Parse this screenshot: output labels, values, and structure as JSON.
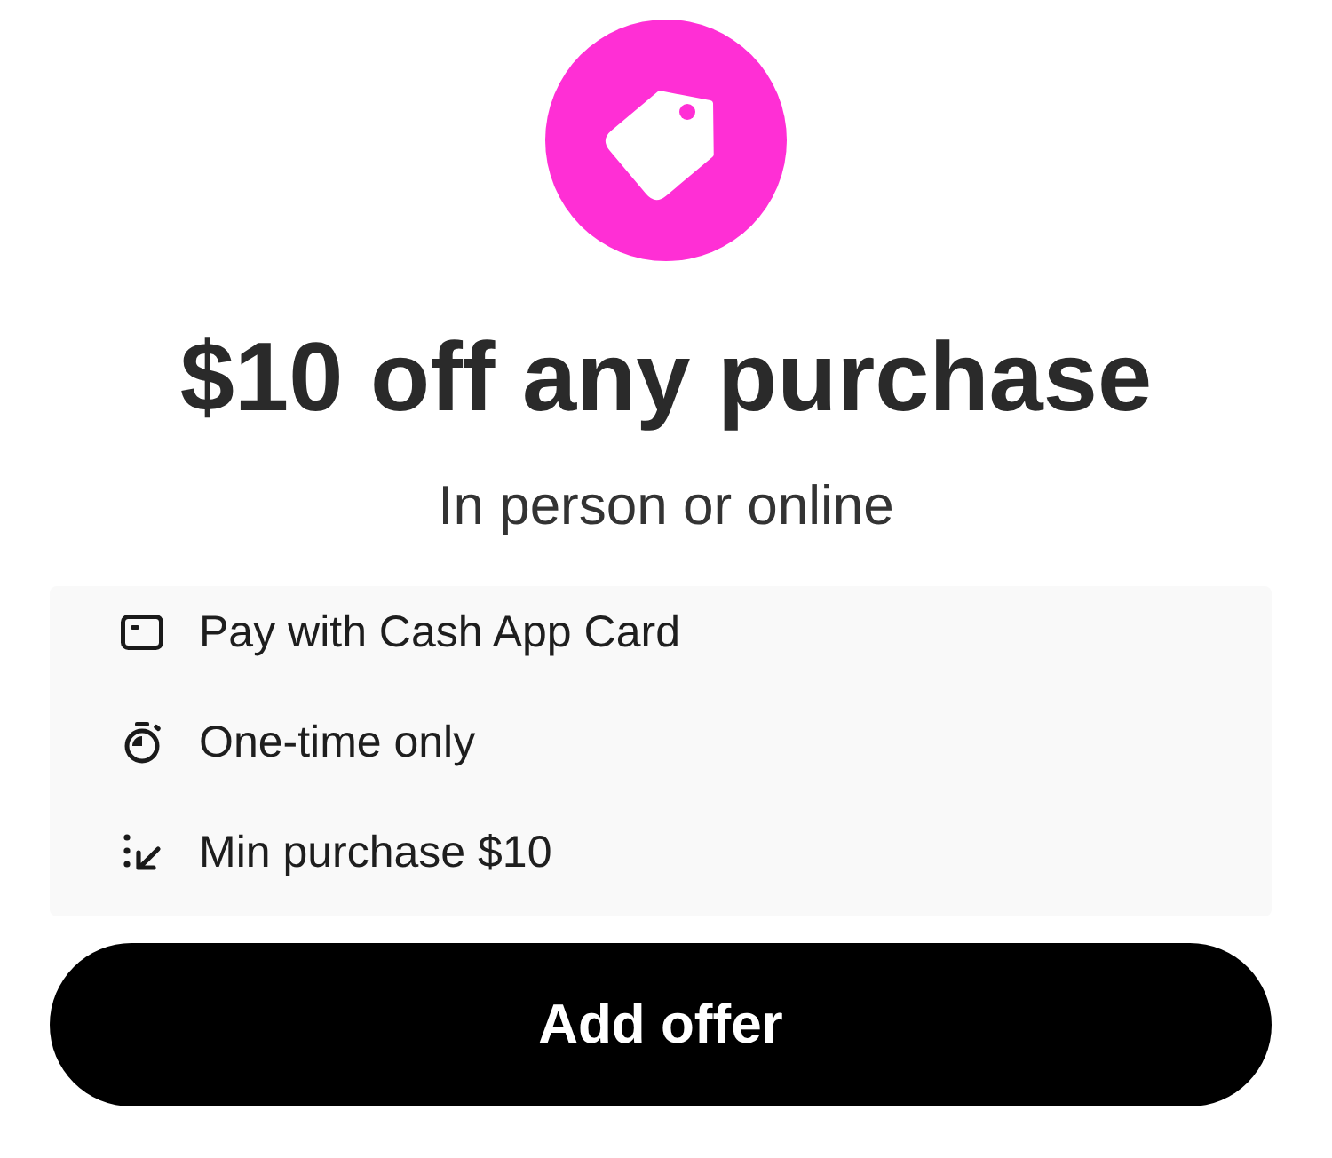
{
  "offer": {
    "title": "$10 off any purchase",
    "subtitle": "In person or online"
  },
  "details": [
    {
      "text": "Pay with Cash App Card"
    },
    {
      "text": "One-time only"
    },
    {
      "text": "Min purchase $10"
    }
  ],
  "button": {
    "label": "Add offer"
  }
}
